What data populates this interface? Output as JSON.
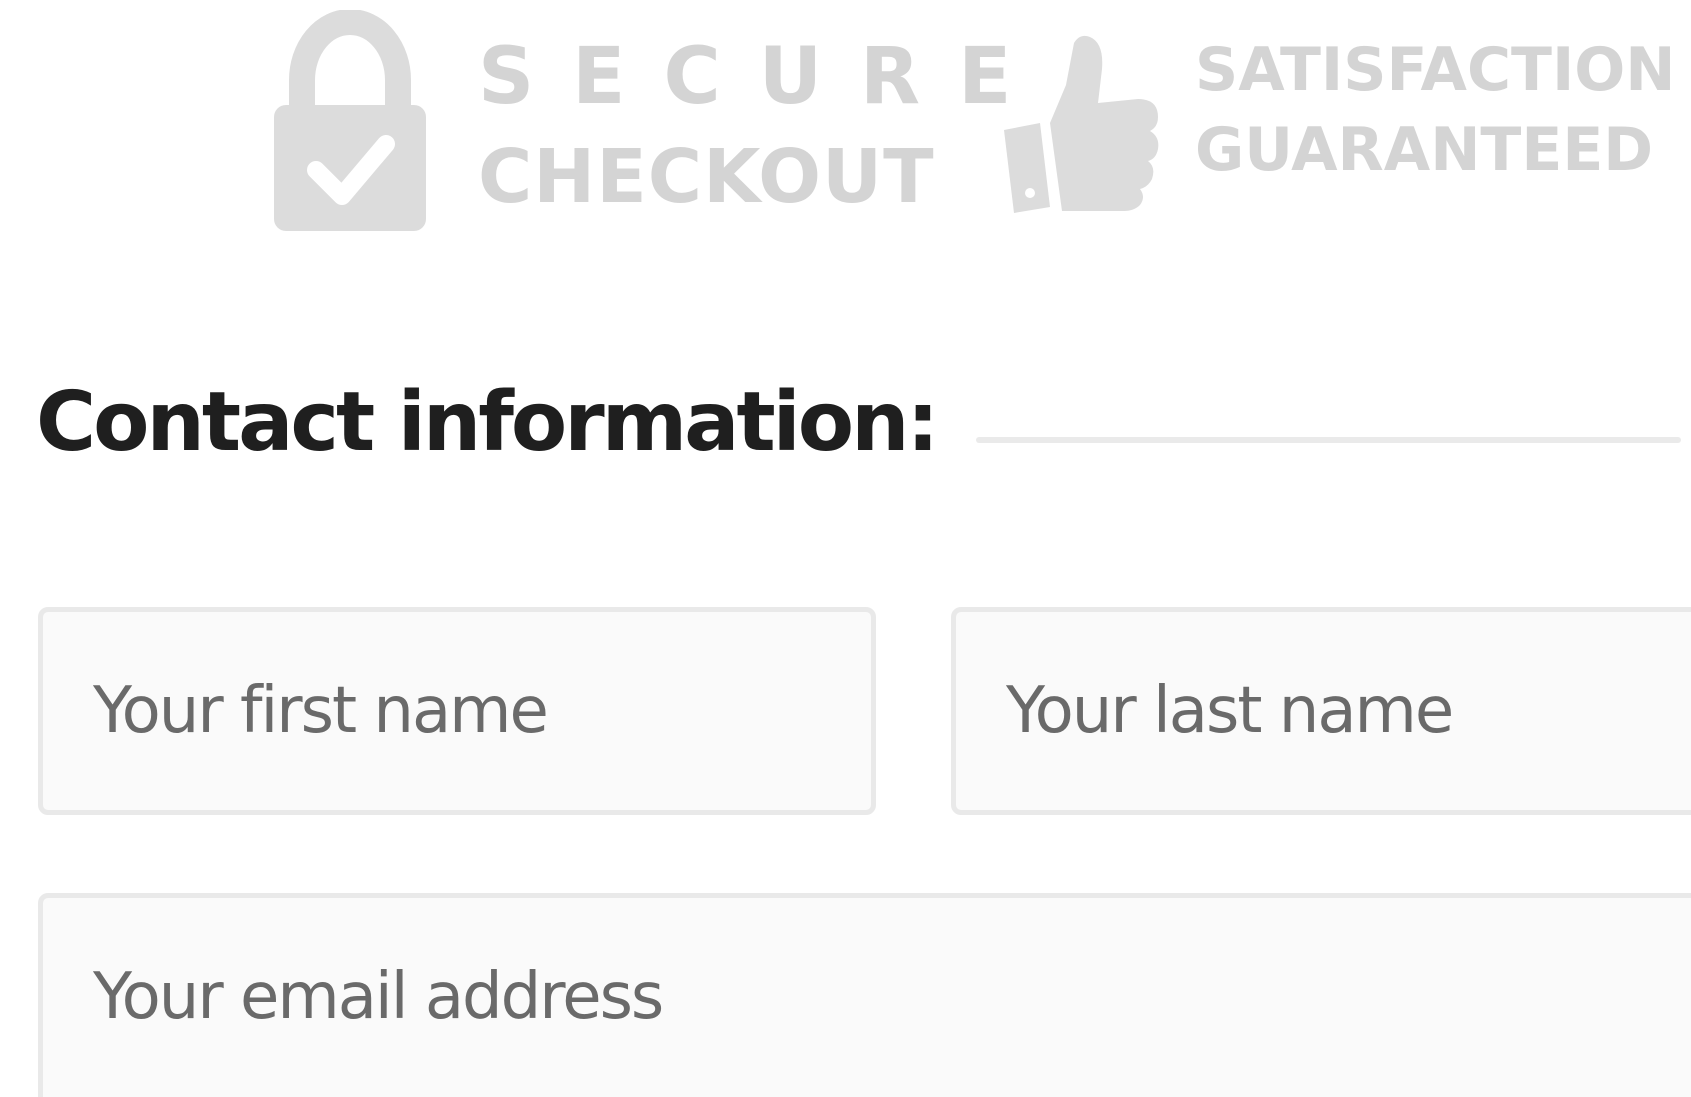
{
  "trust_badges": {
    "secure": {
      "line1": "SECURE",
      "line2": "CHECKOUT",
      "icon": "padlock-with-checkmark-icon"
    },
    "satisfaction": {
      "line1": "SATISFACTION",
      "line2": "GUARANTEED",
      "icon": "thumbs-up-icon"
    },
    "color": "#d4d4d4"
  },
  "contact_section": {
    "title": "Contact information:"
  },
  "form": {
    "first_name": {
      "value": "",
      "placeholder": "Your first name"
    },
    "last_name": {
      "value": "",
      "placeholder": "Your last name"
    },
    "email": {
      "value": "",
      "placeholder": "Your email address"
    }
  },
  "colors": {
    "heading": "#1f1f1f",
    "field_background": "#fafafa",
    "field_border": "#e9e9e9",
    "placeholder": "#6a6a6a",
    "divider": "#eaeaea"
  }
}
